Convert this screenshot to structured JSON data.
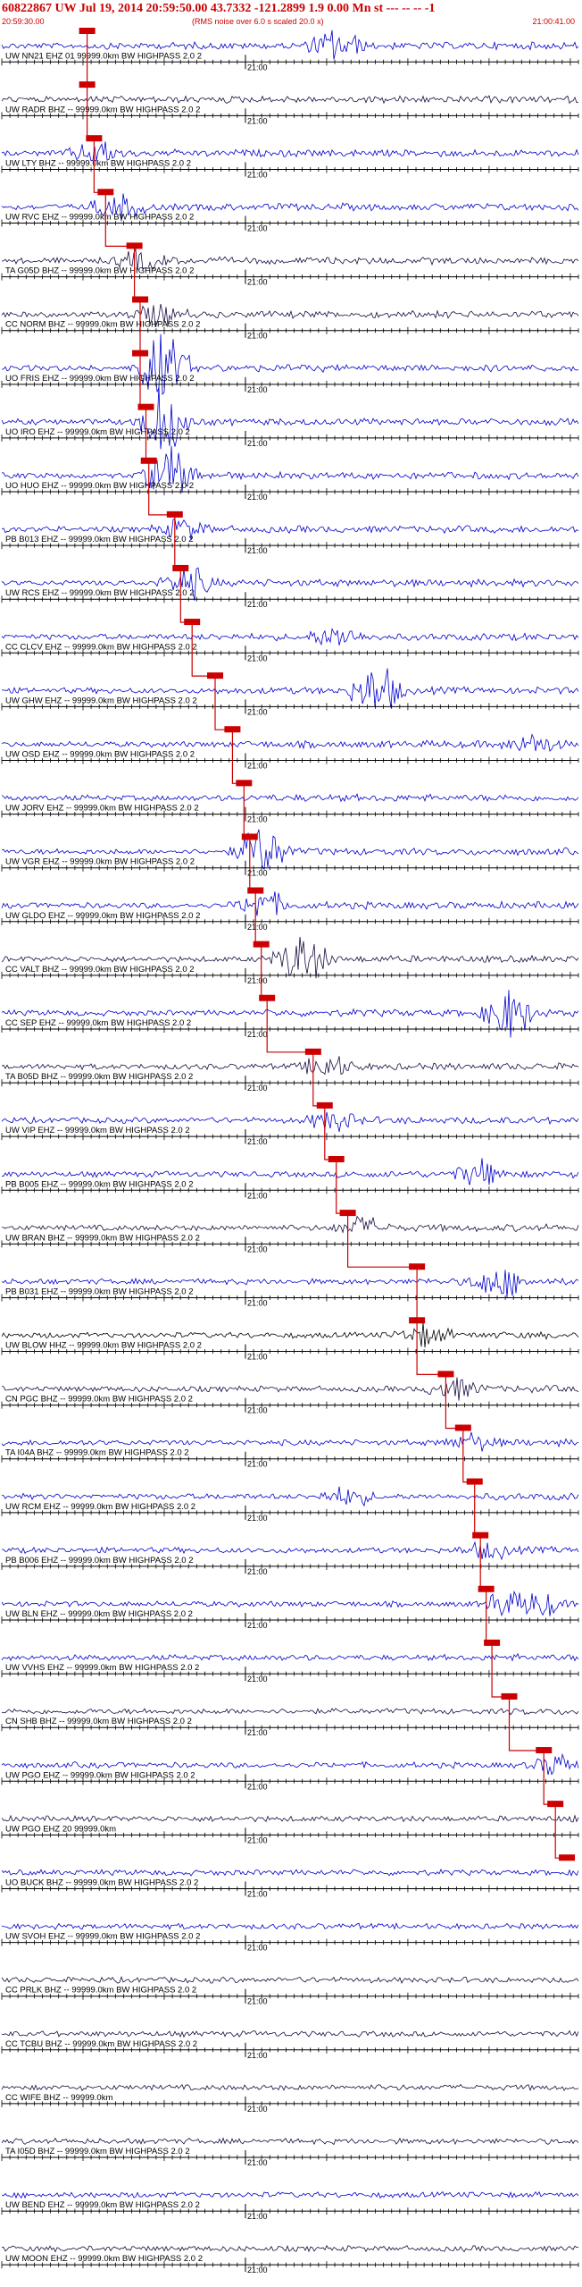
{
  "header": {
    "title": "60822867 UW Jul 19, 2014 20:59:50.00   43.7332 -121.2899  1.9 0.00 Mn st --- -- --  -1",
    "start_time": "20:59:30.00",
    "scale_note": "(RMS noise over 6.0 s scaled 20.0 x)",
    "end_time": "21:00:41.00"
  },
  "time_axis": {
    "minute_label": "21:00",
    "seconds_span": 71
  },
  "colors": {
    "pick": "#cc0000",
    "trace_blue": "#0000cc",
    "trace_dark": "#1a0a40",
    "trace_black": "#000000",
    "axis": "#000000"
  },
  "traces": [
    {
      "label": "UW NN21 EHZ 01 99999.0km BW  HIGHPASS  2.0  2",
      "pick": 0.148,
      "color": "blue",
      "burst_at": 0.58,
      "burst_amp": 1.6
    },
    {
      "label": "UW RADR BHZ -- 99999.0km BW  HIGHPASS  2.0  2",
      "pick": 0.148,
      "color": "dark",
      "burst_at": 0.0,
      "burst_amp": 0
    },
    {
      "label": "UW LTY BHZ -- 99999.0km BW  HIGHPASS  2.0  2",
      "pick": 0.16,
      "color": "blue",
      "burst_at": 0.16,
      "burst_amp": 1.2
    },
    {
      "label": "UW RVC EHZ -- 99999.0km BW  HIGHPASS  2.0  2",
      "pick": 0.18,
      "color": "blue",
      "burst_at": 0.2,
      "burst_amp": 1.4
    },
    {
      "label": "TA G05D BHZ -- 99999.0km BW  HIGHPASS  2.0  2",
      "pick": 0.23,
      "color": "dark",
      "burst_at": 0.24,
      "burst_amp": 1.0
    },
    {
      "label": "CC NORM BHZ -- 99999.0km BW  HIGHPASS  2.0  2",
      "pick": 0.24,
      "color": "dark",
      "burst_at": 0.27,
      "burst_amp": 1.0
    },
    {
      "label": "UO FRIS EHZ -- 99999.0km BW  HIGHPASS  2.0  2",
      "pick": 0.24,
      "color": "blue",
      "burst_at": 0.28,
      "burst_amp": 3.5
    },
    {
      "label": "UO IRO EHZ -- 99999.0km BW  HIGHPASS  2.0  2",
      "pick": 0.25,
      "color": "blue",
      "burst_at": 0.28,
      "burst_amp": 3.5
    },
    {
      "label": "UO HUO EHZ -- 99999.0km BW  HIGHPASS  2.0  2",
      "pick": 0.255,
      "color": "blue",
      "burst_at": 0.29,
      "burst_amp": 2.5
    },
    {
      "label": "PB B013 EHZ -- 99999.0km BW  HIGHPASS  2.0  2",
      "pick": 0.3,
      "color": "blue",
      "burst_at": 0.31,
      "burst_amp": 1.0
    },
    {
      "label": "UW RCS EHZ -- 99999.0km BW  HIGHPASS  2.0  2",
      "pick": 0.31,
      "color": "blue",
      "burst_at": 0.32,
      "burst_amp": 1.6
    },
    {
      "label": "CC CLCV EHZ -- 99999.0km BW  HIGHPASS  2.0  2",
      "pick": 0.33,
      "color": "blue",
      "burst_at": 0.58,
      "burst_amp": 1.0
    },
    {
      "label": "UW GHW EHZ -- 99999.0km BW  HIGHPASS  2.0  2",
      "pick": 0.37,
      "color": "blue",
      "burst_at": 0.65,
      "burst_amp": 2.4
    },
    {
      "label": "UW OSD EHZ -- 99999.0km BW  HIGHPASS  2.0  2",
      "pick": 0.4,
      "color": "blue",
      "burst_at": 0.92,
      "burst_amp": 1.0
    },
    {
      "label": "UW JORV EHZ -- 99999.0km BW  HIGHPASS  2.0  2",
      "pick": 0.42,
      "color": "blue",
      "burst_at": 0.0,
      "burst_amp": 0
    },
    {
      "label": "UW VGR EHZ -- 99999.0km BW  HIGHPASS  2.0  2",
      "pick": 0.43,
      "color": "blue",
      "burst_at": 0.45,
      "burst_amp": 2.8
    },
    {
      "label": "UW GLDO EHZ -- 99999.0km BW  HIGHPASS  2.0  2",
      "pick": 0.44,
      "color": "blue",
      "burst_at": 0.45,
      "burst_amp": 1.4
    },
    {
      "label": "CC VALT BHZ -- 99999.0km BW  HIGHPASS  2.0  2",
      "pick": 0.45,
      "color": "dark",
      "burst_at": 0.52,
      "burst_amp": 2.6
    },
    {
      "label": "CC SEP EHZ -- 99999.0km BW  HIGHPASS  2.0  2",
      "pick": 0.46,
      "color": "blue",
      "burst_at": 0.88,
      "burst_amp": 2.4
    },
    {
      "label": "TA B05D BHZ -- 99999.0km BW  HIGHPASS  2.0  2",
      "pick": 0.54,
      "color": "dark",
      "burst_at": 0.56,
      "burst_amp": 1.2
    },
    {
      "label": "UW VIP EHZ -- 99999.0km BW  HIGHPASS  2.0  2",
      "pick": 0.56,
      "color": "blue",
      "burst_at": 0.57,
      "burst_amp": 1.0
    },
    {
      "label": "PB B005 EHZ -- 99999.0km BW  HIGHPASS  2.0  2",
      "pick": 0.58,
      "color": "blue",
      "burst_at": 0.83,
      "burst_amp": 1.2
    },
    {
      "label": "UW BRAN BHZ -- 99999.0km BW  HIGHPASS  2.0  2",
      "pick": 0.6,
      "color": "dark",
      "burst_at": 0.62,
      "burst_amp": 1.0
    },
    {
      "label": "PB B031 EHZ -- 99999.0km BW  HIGHPASS  2.0  2",
      "pick": 0.72,
      "color": "blue",
      "burst_at": 0.86,
      "burst_amp": 1.6
    },
    {
      "label": "UW BLOW HHZ -- 99999.0km BW  HIGHPASS  2.0  2",
      "pick": 0.72,
      "color": "black",
      "burst_at": 0.73,
      "burst_amp": 1.0
    },
    {
      "label": "CN PGC BHZ -- 99999.0km BW  HIGHPASS  2.0  2",
      "pick": 0.77,
      "color": "dark",
      "burst_at": 0.78,
      "burst_amp": 1.2
    },
    {
      "label": "TA I04A BHZ -- 99999.0km BW  HIGHPASS  2.0  2",
      "pick": 0.8,
      "color": "blue",
      "burst_at": 0.81,
      "burst_amp": 0.8
    },
    {
      "label": "UW RCM EHZ -- 99999.0km BW  HIGHPASS  2.0  2",
      "pick": 0.82,
      "color": "blue",
      "burst_at": 0.6,
      "burst_amp": 1.2
    },
    {
      "label": "PB B006 EHZ -- 99999.0km BW  HIGHPASS  2.0  2",
      "pick": 0.83,
      "color": "blue",
      "burst_at": 0.84,
      "burst_amp": 0.8
    },
    {
      "label": "UW BLN EHZ -- 99999.0km BW  HIGHPASS  2.0  2",
      "pick": 0.84,
      "color": "blue",
      "burst_at": 0.0,
      "burst_amp": 0,
      "clipped_from": 0.84
    },
    {
      "label": "UW VVHS EHZ -- 99999.0km BW  HIGHPASS  2.0  2",
      "pick": 0.85,
      "color": "blue",
      "burst_at": 0.0,
      "burst_amp": 0
    },
    {
      "label": "CN SHB BHZ -- 99999.0km BW  HIGHPASS  2.0  2",
      "pick": 0.88,
      "color": "dark",
      "burst_at": 0.0,
      "burst_amp": 0
    },
    {
      "label": "UW PGO EHZ -- 99999.0km BW  HIGHPASS  2.0  2",
      "pick": 0.94,
      "color": "blue",
      "burst_at": 0.96,
      "burst_amp": 1.0
    },
    {
      "label": "UW PGO EHZ 20 99999.0km",
      "pick": 0.96,
      "color": "dark",
      "burst_at": 0.0,
      "burst_amp": 0
    },
    {
      "label": "UO BUCK BHZ -- 99999.0km BW  HIGHPASS  2.0  2",
      "pick": 0.98,
      "color": "blue",
      "burst_at": 0.0,
      "burst_amp": 0
    },
    {
      "label": "UW SVOH EHZ -- 99999.0km BW  HIGHPASS  2.0  2",
      "pick": null,
      "color": "blue",
      "burst_at": 0.0,
      "burst_amp": 0
    },
    {
      "label": "CC PRLK BHZ -- 99999.0km BW  HIGHPASS  2.0  2",
      "pick": null,
      "color": "dark",
      "burst_at": 0.0,
      "burst_amp": 0
    },
    {
      "label": "CC TCBU BHZ -- 99999.0km BW  HIGHPASS  2.0  2",
      "pick": null,
      "color": "dark",
      "burst_at": 0.0,
      "burst_amp": 0
    },
    {
      "label": "CC WIFE BHZ -- 99999.0km",
      "pick": null,
      "color": "dark",
      "burst_at": 0.0,
      "burst_amp": 0
    },
    {
      "label": "TA I05D BHZ -- 99999.0km BW  HIGHPASS  2.0  2",
      "pick": null,
      "color": "dark",
      "burst_at": 0.0,
      "burst_amp": 0
    },
    {
      "label": "UW BEND EHZ -- 99999.0km BW  HIGHPASS  2.0  2",
      "pick": null,
      "color": "blue",
      "burst_at": 0.0,
      "burst_amp": 0
    },
    {
      "label": "UW MOON EHZ -- 99999.0km BW  HIGHPASS  2.0  2",
      "pick": null,
      "color": "dark",
      "burst_at": 0.0,
      "burst_amp": 0
    }
  ]
}
